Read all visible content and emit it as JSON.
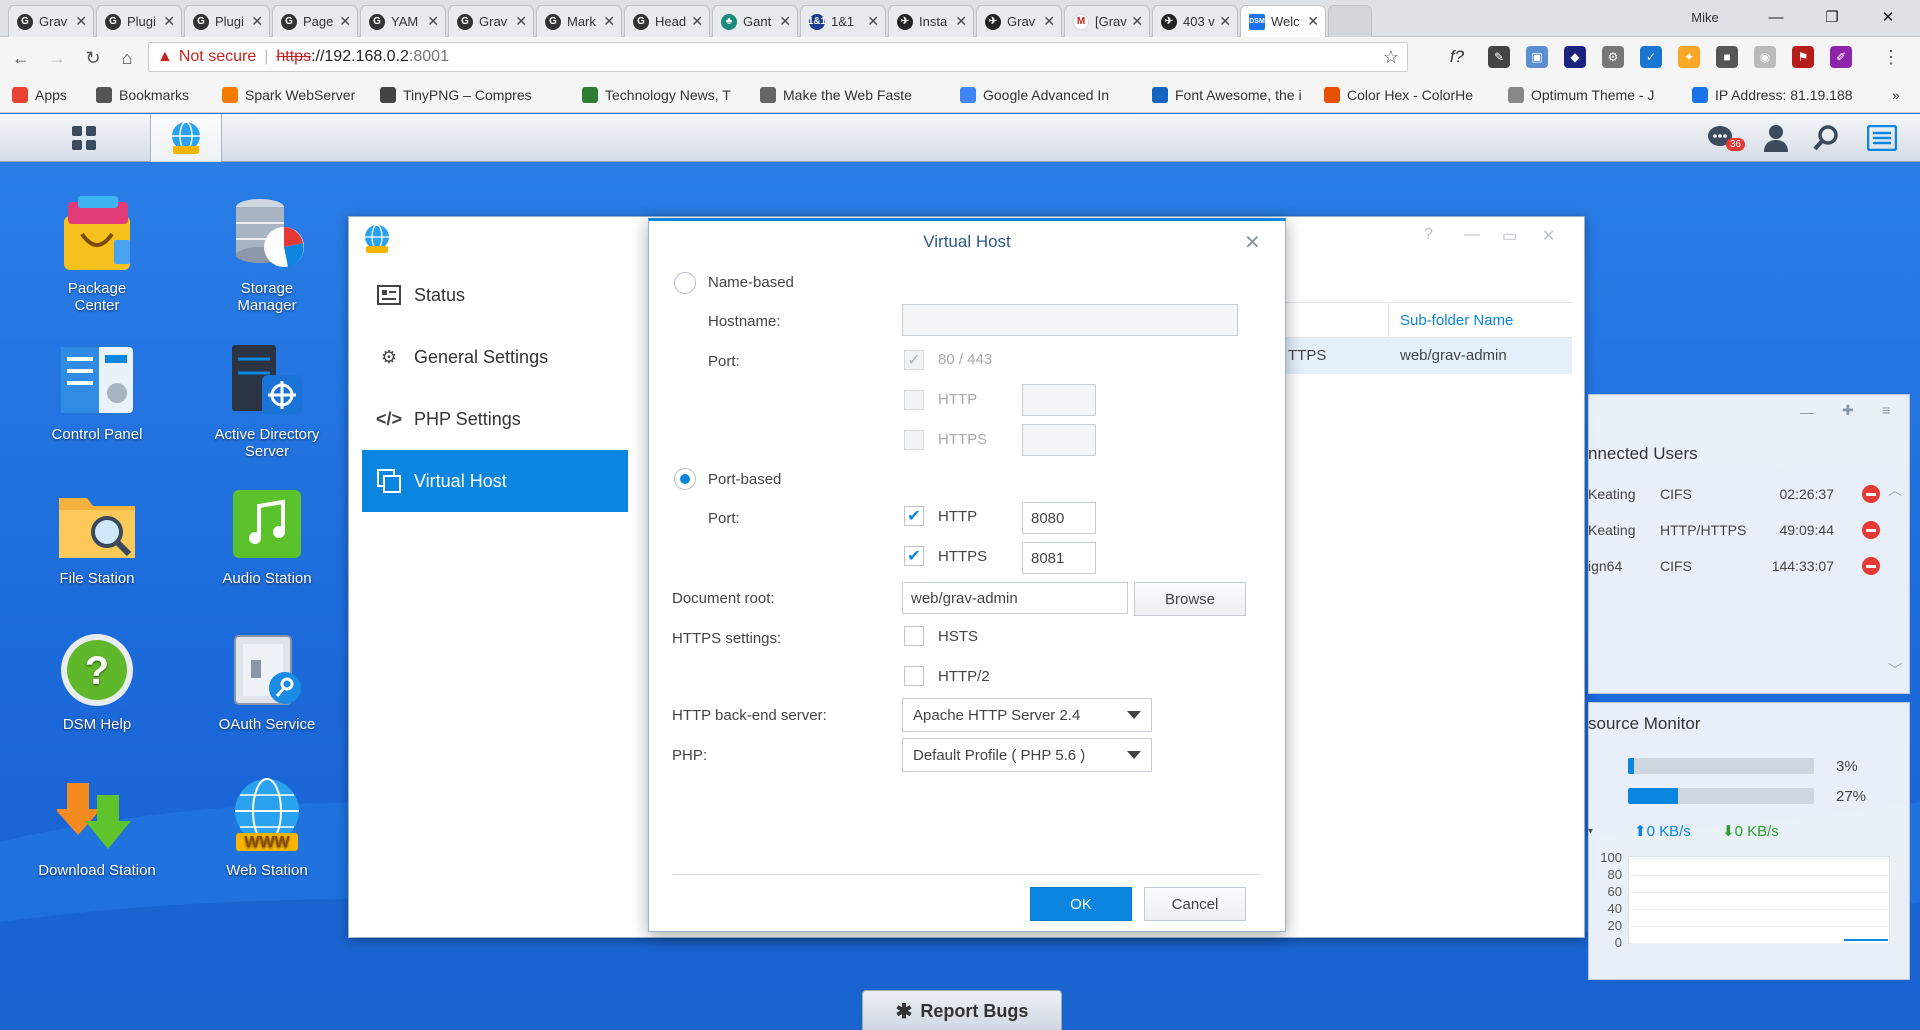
{
  "browser": {
    "tabs": [
      {
        "title": "Grav",
        "icon": "G"
      },
      {
        "title": "Plugi",
        "icon": "G"
      },
      {
        "title": "Plugi",
        "icon": "G"
      },
      {
        "title": "Page",
        "icon": "G"
      },
      {
        "title": "YAM",
        "icon": "G"
      },
      {
        "title": "Grav",
        "icon": "G"
      },
      {
        "title": "Mark",
        "icon": "G"
      },
      {
        "title": "Head",
        "icon": "G"
      },
      {
        "title": "Gant",
        "icon": "♣"
      },
      {
        "title": "1&1",
        "icon": "1&1"
      },
      {
        "title": "Insta",
        "icon": "✈"
      },
      {
        "title": "Grav",
        "icon": "✈"
      },
      {
        "title": "[Grav",
        "icon": "M"
      },
      {
        "title": "403 v",
        "icon": "✈"
      },
      {
        "title": "Welc",
        "icon": "DSM"
      }
    ],
    "profile_name": "Mike",
    "address": {
      "warning_text": "Not secure",
      "scheme": "https",
      "host": "://192.168.0.2",
      "port": ":8001"
    },
    "bookmarks": [
      {
        "label": "Apps",
        "color": "#e94235"
      },
      {
        "label": "Bookmarks",
        "color": "#555555"
      },
      {
        "label": "Spark WebServer",
        "color": "#f57c00"
      },
      {
        "label": "TinyPNG – Compres",
        "color": "#444444"
      },
      {
        "label": "Technology News, T",
        "color": "#2e7d32"
      },
      {
        "label": "Make the Web Faste",
        "color": "#666666"
      },
      {
        "label": "Google Advanced In",
        "color": "#4285f4"
      },
      {
        "label": "Font Awesome, the i",
        "color": "#1565c0"
      },
      {
        "label": "Color Hex - ColorHe",
        "color": "#e65100"
      },
      {
        "label": "Optimum Theme - J",
        "color": "#888888"
      },
      {
        "label": "IP Address: 81.19.188",
        "color": "#1a73e8"
      }
    ]
  },
  "dsm": {
    "notification_count": "36",
    "desktop_icons": [
      {
        "label": "Package Center",
        "label2": ""
      },
      {
        "label": "Storage",
        "label2": "Manager"
      },
      {
        "label": "Control Panel",
        "label2": ""
      },
      {
        "label": "Active Directory",
        "label2": "Server"
      },
      {
        "label": "File Station",
        "label2": ""
      },
      {
        "label": "Audio Station",
        "label2": ""
      },
      {
        "label": "DSM Help",
        "label2": ""
      },
      {
        "label": "OAuth Service",
        "label2": ""
      },
      {
        "label": "Download Station",
        "label2": ""
      },
      {
        "label": "Web Station",
        "label2": ""
      }
    ],
    "pkg_center_line1": "Package",
    "pkg_center_line2": "Center",
    "sidebar": [
      {
        "label": "Status"
      },
      {
        "label": "General Settings"
      },
      {
        "label": "PHP Settings"
      },
      {
        "label": "Virtual Host"
      }
    ],
    "background_table": {
      "column_header": "Sub-folder Name",
      "row_protocol": "TTPS",
      "row_subfolder": "web/grav-admin"
    },
    "dialog": {
      "title": "Virtual Host",
      "name_based_label": "Name-based",
      "hostname_label": "Hostname:",
      "hostname_value": "",
      "port_label": "Port:",
      "port_default": "80 / 443",
      "http_label": "HTTP",
      "https_label": "HTTPS",
      "port_based_label": "Port-based",
      "port_label2": "Port:",
      "http_label2": "HTTP",
      "http_port": "8080",
      "https_label2": "HTTPS",
      "https_port": "8081",
      "doc_root_label": "Document root:",
      "doc_root_value": "web/grav-admin",
      "browse_label": "Browse",
      "https_settings_label": "HTTPS settings:",
      "hsts_label": "HSTS",
      "http2_label": "HTTP/2",
      "backend_label": "HTTP back-end server:",
      "backend_value": "Apache HTTP Server 2.4",
      "php_label": "PHP:",
      "php_value": "Default Profile ( PHP 5.6 )",
      "ok_label": "OK",
      "cancel_label": "Cancel"
    },
    "connected_users": {
      "title": "nnected Users",
      "rows": [
        {
          "user": "Keating",
          "proto": "CIFS",
          "time": "02:26:37"
        },
        {
          "user": "Keating",
          "proto": "HTTP/HTTPS",
          "time": "49:09:44"
        },
        {
          "user": "ign64",
          "proto": "CIFS",
          "time": "144:33:07"
        }
      ]
    },
    "resource_monitor": {
      "title": "source Monitor",
      "cpu_percent": "3%",
      "cpu_fraction": 0.03,
      "ram_percent": "27%",
      "ram_fraction": 0.27,
      "upload": "0 KB/s",
      "download": "0 KB/s",
      "y_ticks": [
        "100",
        "80",
        "60",
        "40",
        "20",
        "0"
      ]
    },
    "report_bugs_label": "Report Bugs"
  }
}
